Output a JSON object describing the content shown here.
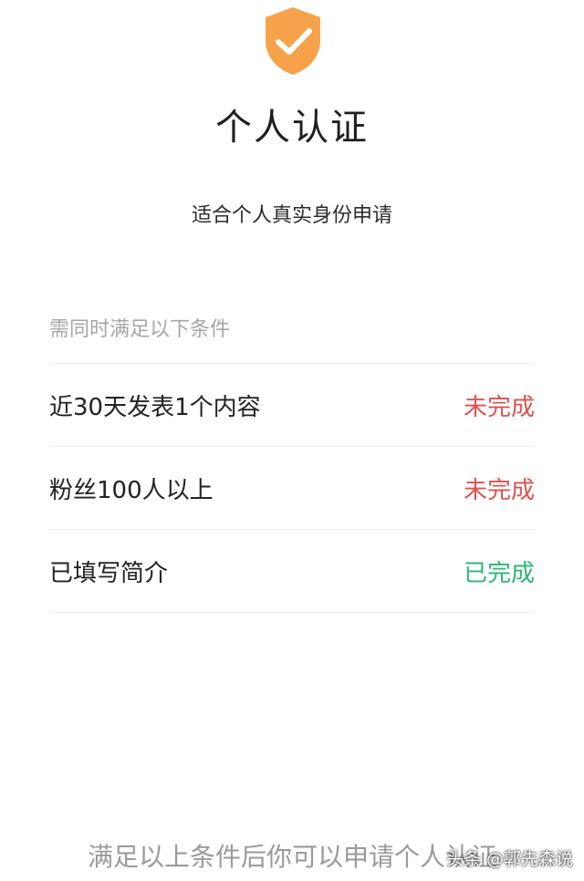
{
  "header": {
    "icon": "shield-check-icon",
    "title": "个人认证",
    "subtitle": "适合个人真实身份申请"
  },
  "requirements": {
    "header": "需同时满足以下条件",
    "items": [
      {
        "label": "近30天发表1个内容",
        "status": "未完成"
      },
      {
        "label": "粉丝100人以上",
        "status": "未完成"
      },
      {
        "label": "已填写简介",
        "status": "已完成"
      }
    ]
  },
  "footer": {
    "note": "满足以上条件后你可以申请个人认证"
  },
  "watermark": {
    "text": "头条 @郭先森说"
  },
  "colors": {
    "shield": "#f5a24b",
    "incomplete": "#e0504f",
    "complete": "#2bb673"
  }
}
